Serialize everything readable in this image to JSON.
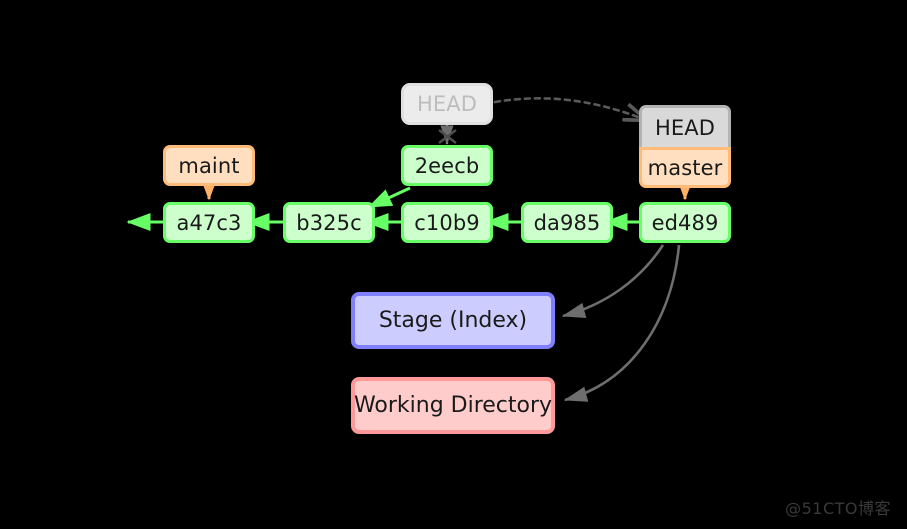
{
  "diagram": {
    "title": "Git HEAD / branch pointer diagram",
    "background_color": "#000000",
    "commit_fill": "#ccffcc",
    "commit_border": "#66ff66",
    "branch_fill": "#ffdfbf",
    "branch_border": "#ffbb77",
    "head_fill": "#d9d9d9",
    "head_border": "#b3b3b3",
    "ghost_fill": "#ececec",
    "ghost_text": "#bdbdbd",
    "stage_fill": "#ccccff",
    "stage_border": "#8080ff",
    "working_fill": "#ffcccc",
    "working_border": "#ff9999",
    "edge_gray": "#6e6e6e",
    "edge_green": "#66ff66",
    "edge_orange": "#ffb266"
  },
  "commits": [
    {
      "id": "a47c3",
      "label": "a47c3"
    },
    {
      "id": "b325c",
      "label": "b325c"
    },
    {
      "id": "c10b9",
      "label": "c10b9"
    },
    {
      "id": "da985",
      "label": "da985"
    },
    {
      "id": "ed489",
      "label": "ed489"
    },
    {
      "id": "2eecb",
      "label": "2eecb"
    }
  ],
  "refs": {
    "maint": "maint",
    "master": "master",
    "head": "HEAD",
    "head_old": "HEAD"
  },
  "areas": {
    "stage": "Stage (Index)",
    "working": "Working Directory"
  },
  "watermark": "@51CTO博客"
}
